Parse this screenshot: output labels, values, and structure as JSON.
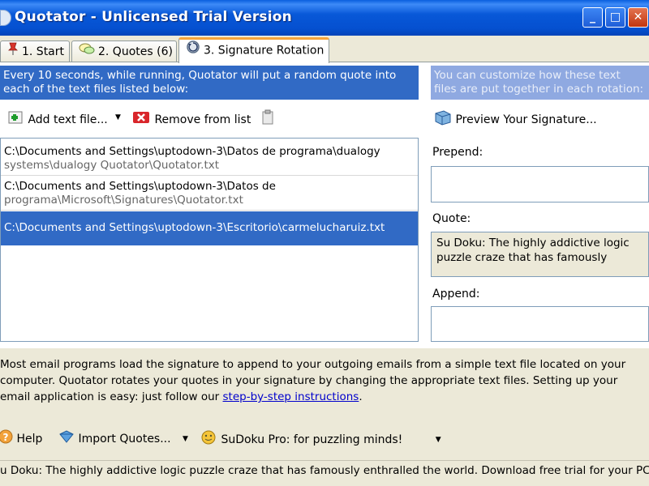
{
  "window": {
    "title": "Quotator - Unlicensed Trial Version",
    "controls": {
      "minimize": "_",
      "maximize": "□",
      "close": "✕"
    }
  },
  "tabs": [
    {
      "label": "1. Start",
      "icon": "pushpin-icon"
    },
    {
      "label": "2. Quotes (6)",
      "icon": "speech-bubble-icon"
    },
    {
      "label": "3. Signature Rotation",
      "icon": "rotation-icon",
      "active": true
    }
  ],
  "info": {
    "left": "Every 10 seconds, while running, Quotator will put a random quote into each of the text files listed below:",
    "right": "You can customize how these text files are put together in each rotation:"
  },
  "toolbar": {
    "add": "Add text file...",
    "remove": "Remove from list",
    "preview": "Preview Your Signature..."
  },
  "files": [
    {
      "line1": "C:\\Documents and Settings\\uptodown-3\\Datos de programa\\dualogy",
      "line2": "systems\\dualogy Quotator\\Quotator.txt"
    },
    {
      "line1": "C:\\Documents and Settings\\uptodown-3\\Datos de",
      "line2": "programa\\Microsoft\\Signatures\\Quotator.txt"
    },
    {
      "line1": "C:\\Documents and Settings\\uptodown-3\\Escritorio\\carmelucharuiz.txt",
      "line2": "",
      "selected": true
    }
  ],
  "fields": {
    "prepend_label": "Prepend:",
    "quote_label": "Quote:",
    "quote_value": "Su Doku: The highly addictive logic puzzle craze that has famously",
    "append_label": "Append:"
  },
  "help": {
    "text": "Most email programs load the signature to append to your outgoing emails from a simple text file located on your computer. Quotator rotates your quotes in your signature by changing the appropriate text files. Setting up your email application is easy: just follow our ",
    "link": "step-by-step instructions",
    "end": "."
  },
  "bottom": {
    "help": "Help",
    "import": "Import Quotes...",
    "sudoku": "SuDoku Pro: for puzzling minds!"
  },
  "status": "u Doku: The highly addictive logic puzzle craze that has famously enthralled the world. Download free trial for your PC ·",
  "colors": {
    "selection": "#316ac5",
    "title_bar": "#0858d8",
    "tab_accent": "#f7a53a"
  }
}
